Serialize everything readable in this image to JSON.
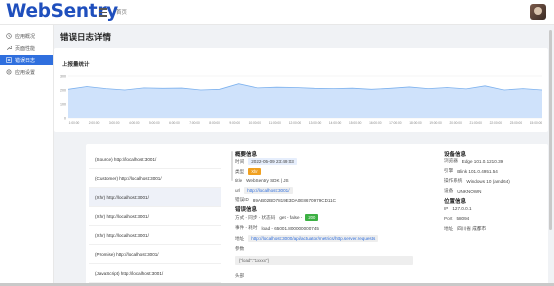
{
  "app": {
    "logo": "WebSentry",
    "breadcrumb": "首页"
  },
  "sidebar": {
    "items": [
      {
        "label": "应用概况",
        "icon": "clock-icon"
      },
      {
        "label": "页面性能",
        "icon": "wrench-icon"
      },
      {
        "label": "错误日志",
        "icon": "list-icon",
        "active": true
      },
      {
        "label": "应用设置",
        "icon": "gear-icon"
      }
    ]
  },
  "page": {
    "title": "错误日志详情"
  },
  "chart_card": {
    "title": "上报量统计"
  },
  "chart_data": {
    "type": "area",
    "x": [
      "1:00:00",
      "2:00:00",
      "3:00:00",
      "4:00:00",
      "5:00:00",
      "6:00:00",
      "7:00:00",
      "8:00:00",
      "9:00:00",
      "10:00:00",
      "11:00:00",
      "12:00:00",
      "13:00:00",
      "14:00:00",
      "15:00:00",
      "16:00:00",
      "17:00:00",
      "18:00:00",
      "19:00:00",
      "20:00:00",
      "21:00:00",
      "22:00:00",
      "23:00:00",
      "15:00:00"
    ],
    "values": [
      205,
      225,
      210,
      200,
      215,
      212,
      214,
      200,
      205,
      245,
      215,
      220,
      218,
      212,
      210,
      213,
      205,
      212,
      222,
      210,
      218,
      208,
      230,
      200,
      210,
      200
    ],
    "yticks": [
      0,
      100,
      200,
      300
    ],
    "ylim": [
      0,
      300
    ],
    "color": "#7eb2ee",
    "grid": true
  },
  "error_list": [
    "(Source) http://localhost:3001/",
    "(Customer) http://localhost:3001/",
    "(Xhr) http://localhost:3001/",
    "(Xhr) http://localhost:3001/",
    "(Xhr) http://localhost:3001/",
    "(Promise) http://localhost:3001/",
    "(JavaScript) http://localhost:3001/"
  ],
  "overview": {
    "title": "概要信息",
    "time_label": "时间",
    "time_value": "2022-05-09 23:49:03",
    "type_label": "类型",
    "type_value": "Xhr",
    "title_label": "title",
    "title_value": "WebSentry SDK | JS",
    "url_label": "url",
    "url_value": "http://localhost:3001/",
    "id_label": "错误ID",
    "id_value": "89AB02BD7819E3DA0E8670979CD11C"
  },
  "error_info": {
    "title": "错误信息",
    "method_label": "方式 - 同步 - 状态码",
    "method_value": "get - false -",
    "status_value": "200",
    "event_label": "事件 - 耗时",
    "event_value": "load - 65001.800000000745",
    "addr_label": "地址",
    "addr_value": "http://localhost:3000/api/actuator/metrics/http.server.requests",
    "params_label": "参数",
    "params_value": "{\"load\":\"1xxxx\"}",
    "header_label": "头部"
  },
  "device": {
    "title": "设备信息",
    "browser_label": "浏览器",
    "browser_value": "Edge 101.0.1210.39",
    "engine_label": "引擎",
    "engine_value": "Blink 101.0.4951.54",
    "os_label": "操作系统",
    "os_value": "Windows 10 (amd64)",
    "device_label": "设备",
    "device_value": "UNKNOWN"
  },
  "location": {
    "title": "位置信息",
    "ip_label": "IP",
    "ip_value": "127.0.0.1",
    "port_label": "Port",
    "port_value": "58094",
    "addr_label": "地址",
    "addr_value": "四川省 成都市"
  }
}
